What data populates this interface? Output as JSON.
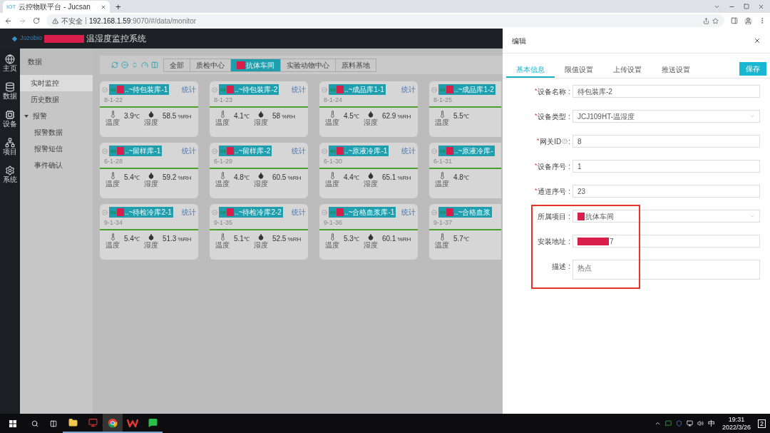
{
  "browser": {
    "tab_badge": "IOT",
    "tab_title": "云控物联平台 - Jucsan",
    "new_tab": "+",
    "security": "不安全",
    "url_host": "192.168.1.59",
    "url_path": ":9070/#/data/monitor"
  },
  "app_header": {
    "logo_text": "Jozobio",
    "title": "温湿度监控系统"
  },
  "rail": [
    {
      "kind": "globe",
      "label": "主页"
    },
    {
      "kind": "data",
      "label": "数据"
    },
    {
      "kind": "device",
      "label": "设备"
    },
    {
      "kind": "project",
      "label": "项目"
    },
    {
      "kind": "system",
      "label": "系统"
    }
  ],
  "submenu": {
    "title": "数据",
    "items": [
      {
        "label": "实时监控",
        "selected": true
      },
      {
        "label": "历史数据",
        "selected": false
      },
      {
        "label": "报警",
        "selected": false,
        "expanded": true,
        "children": [
          {
            "label": "报警数据",
            "selected": false
          },
          {
            "label": "报警短信",
            "selected": false
          },
          {
            "label": "事件确认",
            "selected": false
          }
        ]
      }
    ]
  },
  "toolbar": {
    "tabs": [
      {
        "label": "全部",
        "selected": false
      },
      {
        "label": "质检中心",
        "selected": false
      },
      {
        "label": "抗体车间",
        "selected": true
      },
      {
        "label": "实验动物中心",
        "selected": false
      },
      {
        "label": "原料基地",
        "selected": false
      }
    ]
  },
  "cards": [
    {
      "name": "..~待包装库-1",
      "code": "8-1-22",
      "link": "统计",
      "temperature": "3.9",
      "temperature_unit": "℃",
      "temperature_label": "温度",
      "humidity": "58.5",
      "humidity_unit": "%RH",
      "humidity_label": "湿度"
    },
    {
      "name": "..~待包装库-2",
      "code": "8-1-23",
      "link": "统计",
      "temperature": "4.1",
      "temperature_unit": "℃",
      "temperature_label": "温度",
      "humidity": "58",
      "humidity_unit": "%RH",
      "humidity_label": "湿度"
    },
    {
      "name": "..~成品库1-1",
      "code": "8-1-24",
      "link": "统计",
      "temperature": "4.5",
      "temperature_unit": "℃",
      "temperature_label": "温度",
      "humidity": "62.9",
      "humidity_unit": "%RH",
      "humidity_label": "湿度"
    },
    {
      "name": "..~成品库1-2",
      "code": "8-1-25",
      "temperature": "5.5",
      "temperature_unit": "℃",
      "temperature_label": "温度"
    },
    {
      "name": "..~留样库-1",
      "code": "6-1-28",
      "link": "统计",
      "temperature": "5.4",
      "temperature_unit": "℃",
      "temperature_label": "温度",
      "humidity": "59.2",
      "humidity_unit": "%RH",
      "humidity_label": "湿度"
    },
    {
      "name": "..~留样库-2",
      "code": "6-1-29",
      "link": "统计",
      "temperature": "4.8",
      "temperature_unit": "℃",
      "temperature_label": "温度",
      "humidity": "60.5",
      "humidity_unit": "%RH",
      "humidity_label": "湿度"
    },
    {
      "name": "..~原液冷库-1",
      "code": "6-1-30",
      "link": "统计",
      "temperature": "4.4",
      "temperature_unit": "℃",
      "temperature_label": "温度",
      "humidity": "65.1",
      "humidity_unit": "%RH",
      "humidity_label": "湿度"
    },
    {
      "name": "..~原液冷库-",
      "code": "6-1-31",
      "temperature": "4.8",
      "temperature_unit": "℃",
      "temperature_label": "温度"
    },
    {
      "name": "..~待检冷库2-1",
      "code": "9-1-34",
      "link": "统计",
      "temperature": "5.4",
      "temperature_unit": "℃",
      "temperature_label": "温度",
      "humidity": "51.3",
      "humidity_unit": "%RH",
      "humidity_label": "湿度"
    },
    {
      "name": "..~待检冷库2-2",
      "code": "9-1-35",
      "link": "统计",
      "temperature": "5.1",
      "temperature_unit": "℃",
      "temperature_label": "温度",
      "humidity": "52.5",
      "humidity_unit": "%RH",
      "humidity_label": "湿度"
    },
    {
      "name": "..~合格血浆库-1",
      "code": "9-1-36",
      "link": "统计",
      "temperature": "5.3",
      "temperature_unit": "℃",
      "temperature_label": "温度",
      "humidity": "60.1",
      "humidity_unit": "%RH",
      "humidity_label": "湿度"
    },
    {
      "name": "..~合格血浆",
      "code": "9-1-37",
      "temperature": "5.7",
      "temperature_unit": "℃",
      "temperature_label": "温度"
    }
  ],
  "drawer": {
    "title": "编辑",
    "tabs": [
      {
        "label": "基本信息",
        "selected": true
      },
      {
        "label": "限值设置",
        "selected": false
      },
      {
        "label": "上传设置",
        "selected": false
      },
      {
        "label": "推送设置",
        "selected": false
      }
    ],
    "save": "保存",
    "fields": [
      {
        "kind": "input",
        "required_mark": "*",
        "label": "设备名称 :",
        "value": "待包装库-2"
      },
      {
        "kind": "select",
        "required_mark": "*",
        "label": "设备类型 :",
        "value": "JCJ109HT-温湿度"
      },
      {
        "kind": "input",
        "required_mark": "*",
        "label": "网关ID",
        "help": true,
        "colon": ":",
        "value": "8"
      },
      {
        "kind": "input",
        "required_mark": "*",
        "label": "设备序号 :",
        "value": "1"
      },
      {
        "kind": "input",
        "required_mark": "*",
        "label": "通道序号 :",
        "value": "23"
      },
      {
        "kind": "select",
        "label": "所属项目 :",
        "redacted": true,
        "value": "抗体车间"
      },
      {
        "kind": "input",
        "label": "安装地址 :",
        "redacted": true,
        "value": "7"
      },
      {
        "kind": "textarea",
        "label": "描述 :",
        "value": "热点"
      }
    ]
  },
  "taskbar": {
    "apps": [
      {
        "kind": "explorer",
        "open": true
      },
      {
        "kind": "monitor",
        "open": true
      },
      {
        "kind": "chrome",
        "open": true
      },
      {
        "kind": "wps",
        "open": true
      },
      {
        "kind": "wechat",
        "open": true
      }
    ],
    "ime": "中",
    "time": "19:31",
    "date": "2022/3/26",
    "notifications": "2"
  }
}
